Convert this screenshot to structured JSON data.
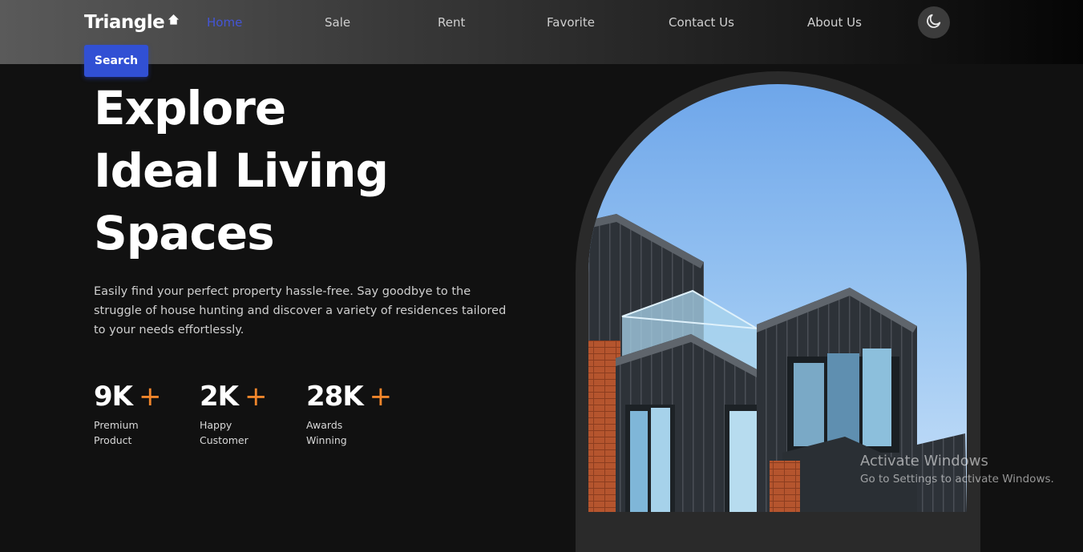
{
  "header": {
    "logo": "Triangle",
    "logo_icon": "home-icon",
    "nav": [
      "Home",
      "Sale",
      "Rent",
      "Favorite",
      "Contact Us",
      "About Us"
    ],
    "active_nav": "Home",
    "theme_toggle_icon": "moon-icon",
    "search_label": "Search"
  },
  "hero": {
    "title_lines": [
      "Explore",
      "Ideal Living",
      "Spaces"
    ],
    "description": "Easily find your perfect property hassle-free. Say goodbye to the struggle of house hunting and discover a variety of residences tailored to your needs effortlessly.",
    "stats": [
      {
        "value": "9K",
        "suffix": "+",
        "label_lines": [
          "Premium",
          "Product"
        ]
      },
      {
        "value": "2K",
        "suffix": "+",
        "label_lines": [
          "Happy",
          "Customer"
        ]
      },
      {
        "value": "28K",
        "suffix": "+",
        "label_lines": [
          "Awards",
          "Winning"
        ]
      }
    ],
    "image": "modern-apartment-building-photo"
  },
  "watermark": {
    "title": "Activate Windows",
    "subtitle": "Go to Settings to activate Windows."
  },
  "colors": {
    "background": "#111111",
    "accent": "#3150d4",
    "active_nav": "#4455d6",
    "plus": "#f0852b"
  }
}
